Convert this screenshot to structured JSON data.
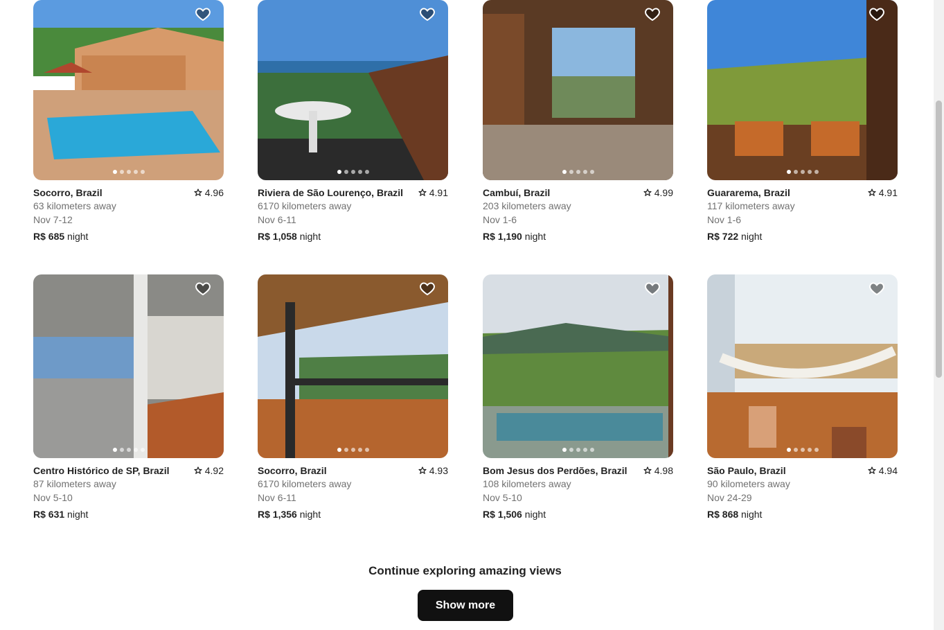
{
  "listings": [
    {
      "location": "Socorro, Brazil",
      "rating": "4.96",
      "distance": "63 kilometers away",
      "dates": "Nov 7-12",
      "price": "R$ 685",
      "unit": "night"
    },
    {
      "location": "Riviera de São Lourenço, Brazil",
      "rating": "4.91",
      "distance": "6170 kilometers away",
      "dates": "Nov 6-11",
      "price": "R$ 1,058",
      "unit": "night"
    },
    {
      "location": "Cambuí, Brazil",
      "rating": "4.99",
      "distance": "203 kilometers away",
      "dates": "Nov 1-6",
      "price": "R$ 1,190",
      "unit": "night"
    },
    {
      "location": "Guararema, Brazil",
      "rating": "4.91",
      "distance": "117 kilometers away",
      "dates": "Nov 1-6",
      "price": "R$ 722",
      "unit": "night"
    },
    {
      "location": "Centro Histórico de SP, Brazil",
      "rating": "4.92",
      "distance": "87 kilometers away",
      "dates": "Nov 5-10",
      "price": "R$ 631",
      "unit": "night"
    },
    {
      "location": "Socorro, Brazil",
      "rating": "4.93",
      "distance": "6170 kilometers away",
      "dates": "Nov 6-11",
      "price": "R$ 1,356",
      "unit": "night"
    },
    {
      "location": "Bom Jesus dos Perdões, Brazil",
      "rating": "4.98",
      "distance": "108 kilometers away",
      "dates": "Nov 5-10",
      "price": "R$ 1,506",
      "unit": "night"
    },
    {
      "location": "São Paulo, Brazil",
      "rating": "4.94",
      "distance": "90 kilometers away",
      "dates": "Nov 24-29",
      "price": "R$ 868",
      "unit": "night"
    }
  ],
  "footer": {
    "title": "Continue exploring amazing views",
    "button": "Show more"
  },
  "icons": {
    "favorite": "heart-icon",
    "rating": "star-icon"
  },
  "colors": {
    "text": "#222222",
    "muted": "#717171",
    "button_bg": "#111111"
  }
}
